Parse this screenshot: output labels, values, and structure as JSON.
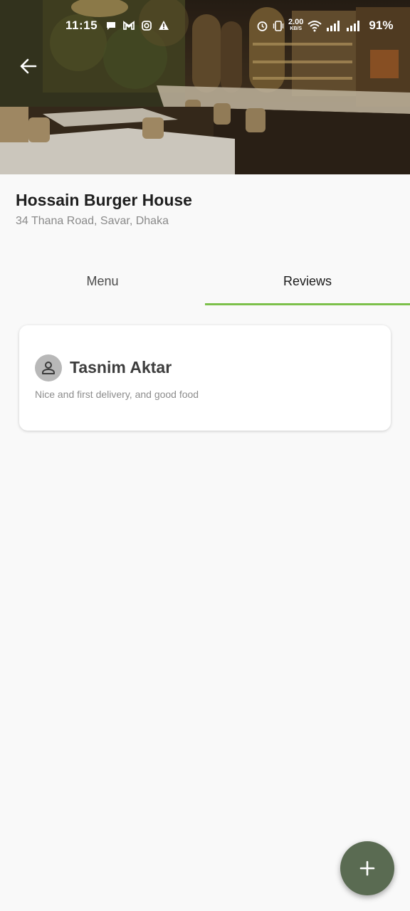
{
  "status_bar": {
    "time": "11:15",
    "net_speed_value": "2.00",
    "net_speed_unit": "KB/S",
    "battery": "91%",
    "left_icons": [
      "chat-bubble-icon",
      "gmail-icon",
      "instagram-icon",
      "warning-icon"
    ],
    "right_icons": [
      "alarm-icon",
      "vibrate-icon",
      "wifi-icon",
      "signal-icon",
      "signal-icon"
    ]
  },
  "header": {
    "image": "restaurant-interior-photo",
    "back_icon": "arrow-left-icon"
  },
  "restaurant": {
    "name": "Hossain Burger House",
    "address": "34 Thana Road, Savar, Dhaka"
  },
  "tabs": [
    {
      "label": "Menu",
      "selected": false
    },
    {
      "label": "Reviews",
      "selected": true
    }
  ],
  "reviews": [
    {
      "author": "Tasnim Aktar",
      "avatar_icon": "person-icon",
      "text": "Nice and first delivery, and good food"
    }
  ],
  "fab": {
    "icon": "plus-icon"
  },
  "colors": {
    "accent": "#7cc04b",
    "fab": "#5a6b52",
    "background": "#f9f9f9"
  }
}
